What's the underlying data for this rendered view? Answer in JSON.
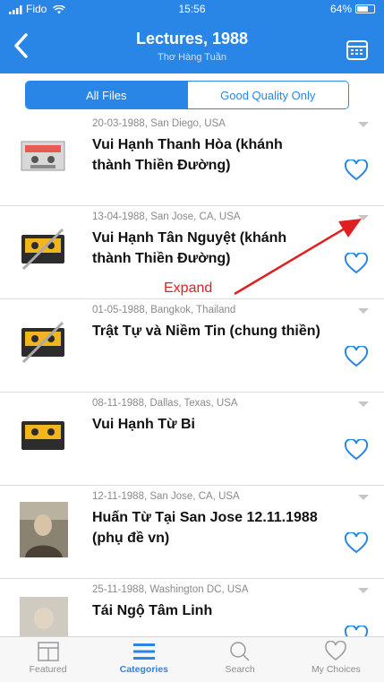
{
  "status_bar": {
    "carrier": "Fido",
    "time": "15:56",
    "battery": "64%",
    "battery_level": 0.64
  },
  "header": {
    "title": "Lectures, 1988",
    "subtitle": "Thơ Hàng Tuần"
  },
  "segment": {
    "all": "All Files",
    "good": "Good Quality Only",
    "selected": "All Files"
  },
  "items": [
    {
      "meta": "20-03-1988, San Diego, USA",
      "title": "Vui Hạnh Thanh Hòa (khánh thành Thiền Đường)",
      "thumb": "cassette-gray-icon"
    },
    {
      "meta": "13-04-1988, San Jose, CA, USA",
      "title": "Vui Hạnh Tân Nguyệt (khánh thành Thiền Đường)",
      "thumb": "cassette-crossed-icon"
    },
    {
      "meta": "01-05-1988, Bangkok, Thailand",
      "title": "Trật Tự và Niềm Tin (chung thiền)",
      "thumb": "cassette-crossed-icon"
    },
    {
      "meta": "08-11-1988, Dallas, Texas, USA",
      "title": "Vui Hạnh Từ Bi",
      "thumb": "cassette-icon"
    },
    {
      "meta": "12-11-1988, San Jose, CA, USA",
      "title": "Huấn Từ Tại San Jose 12.11.1988 (phụ đề vn)",
      "thumb": "speaker-photo"
    },
    {
      "meta": "25-11-1988, Washington DC, USA",
      "title": "Tái Ngộ Tâm Linh",
      "thumb": "speaker-photo"
    }
  ],
  "annotation": {
    "label": "Expand"
  },
  "tabs": [
    {
      "label": "Featured",
      "icon": "featured-icon"
    },
    {
      "label": "Categories",
      "icon": "list-icon"
    },
    {
      "label": "Search",
      "icon": "search-icon"
    },
    {
      "label": "My Choices",
      "icon": "heart-icon"
    }
  ],
  "colors": {
    "accent": "#2a86e6",
    "annotation": "#e02020"
  }
}
